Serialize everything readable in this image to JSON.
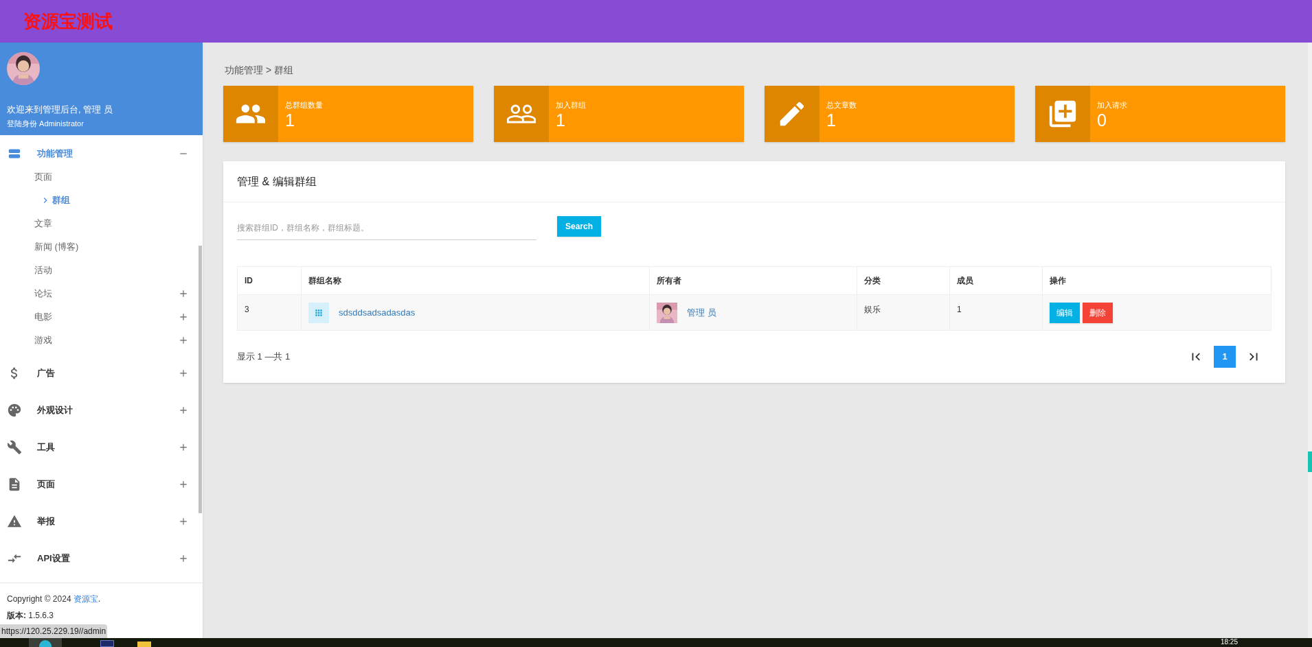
{
  "header": {
    "title": "资源宝测试"
  },
  "profile": {
    "welcome": "欢迎来到管理后台, 管理 员",
    "role": "登陆身份 Administrator"
  },
  "sidebar": {
    "items": [
      {
        "label": "功能管理",
        "expanded": true,
        "children": [
          {
            "label": "页面",
            "selected": false
          },
          {
            "label": "群组",
            "selected": true
          },
          {
            "label": "文章",
            "selected": false
          },
          {
            "label": "新闻 (博客)",
            "selected": false
          },
          {
            "label": "活动",
            "selected": false
          },
          {
            "label": "论坛",
            "selected": false,
            "expanded": false
          },
          {
            "label": "电影",
            "selected": false,
            "expanded": false
          },
          {
            "label": "游戏",
            "selected": false,
            "expanded": false
          }
        ]
      },
      {
        "label": "广告",
        "expanded": false
      },
      {
        "label": "外观设计",
        "expanded": false
      },
      {
        "label": "工具",
        "expanded": false
      },
      {
        "label": "页面",
        "expanded": false
      },
      {
        "label": "举报",
        "expanded": false
      },
      {
        "label": "API设置",
        "expanded": false
      }
    ],
    "copyright": "Copyright © 2024",
    "copyright_link": "资源宝",
    "copyright_end": ".",
    "version_label": "版本:",
    "version": "1.5.6.3"
  },
  "breadcrumb": "功能管理 > 群组",
  "stats": [
    {
      "label": "总群组数量",
      "value": "1"
    },
    {
      "label": "加入群组",
      "value": "1"
    },
    {
      "label": "总文章数",
      "value": "1"
    },
    {
      "label": "加入请求",
      "value": "0"
    }
  ],
  "panel": {
    "title": "管理 & 编辑群组",
    "search": {
      "placeholder": "搜索群组ID，群组名称，群组标题。",
      "button": "Search"
    },
    "table": {
      "columns": [
        "ID",
        "群组名称",
        "所有者",
        "分类",
        "成员",
        "操作"
      ],
      "rows": [
        {
          "id": "3",
          "name": "sdsddsadsadasdas",
          "owner": "管理 员",
          "category": "娱乐",
          "members": "1",
          "actions": [
            "编辑",
            "删除"
          ]
        }
      ]
    },
    "summary": "显示 1 —共 1",
    "pages": [
      {
        "label": "1",
        "selected": true
      }
    ]
  },
  "status_url": "https://120.25.229.19//admin",
  "taskbar": {
    "time": "18:25"
  }
}
